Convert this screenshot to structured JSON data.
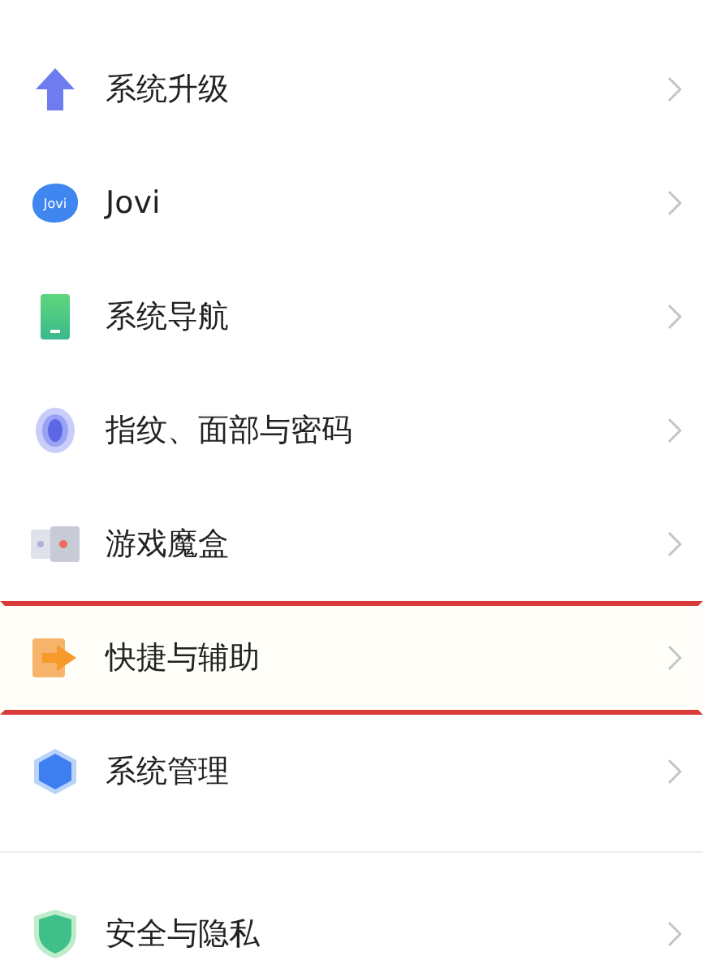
{
  "sections": [
    {
      "items": [
        {
          "kind": "upgrade",
          "label": "系统升级",
          "highlighted": false
        },
        {
          "kind": "assistant",
          "icon_label": "Jovi",
          "label": "Jovi",
          "highlighted": false
        },
        {
          "kind": "navigation",
          "label": "系统导航",
          "highlighted": false
        },
        {
          "kind": "fingerprint",
          "label": "指纹、面部与密码",
          "highlighted": false
        },
        {
          "kind": "gamebox",
          "label": "游戏魔盒",
          "highlighted": false
        },
        {
          "kind": "shortcut",
          "label": "快捷与辅助",
          "highlighted": true
        },
        {
          "kind": "management",
          "label": "系统管理",
          "highlighted": false
        }
      ]
    },
    {
      "items": [
        {
          "kind": "security",
          "label": "安全与隐私",
          "highlighted": false
        }
      ]
    }
  ]
}
